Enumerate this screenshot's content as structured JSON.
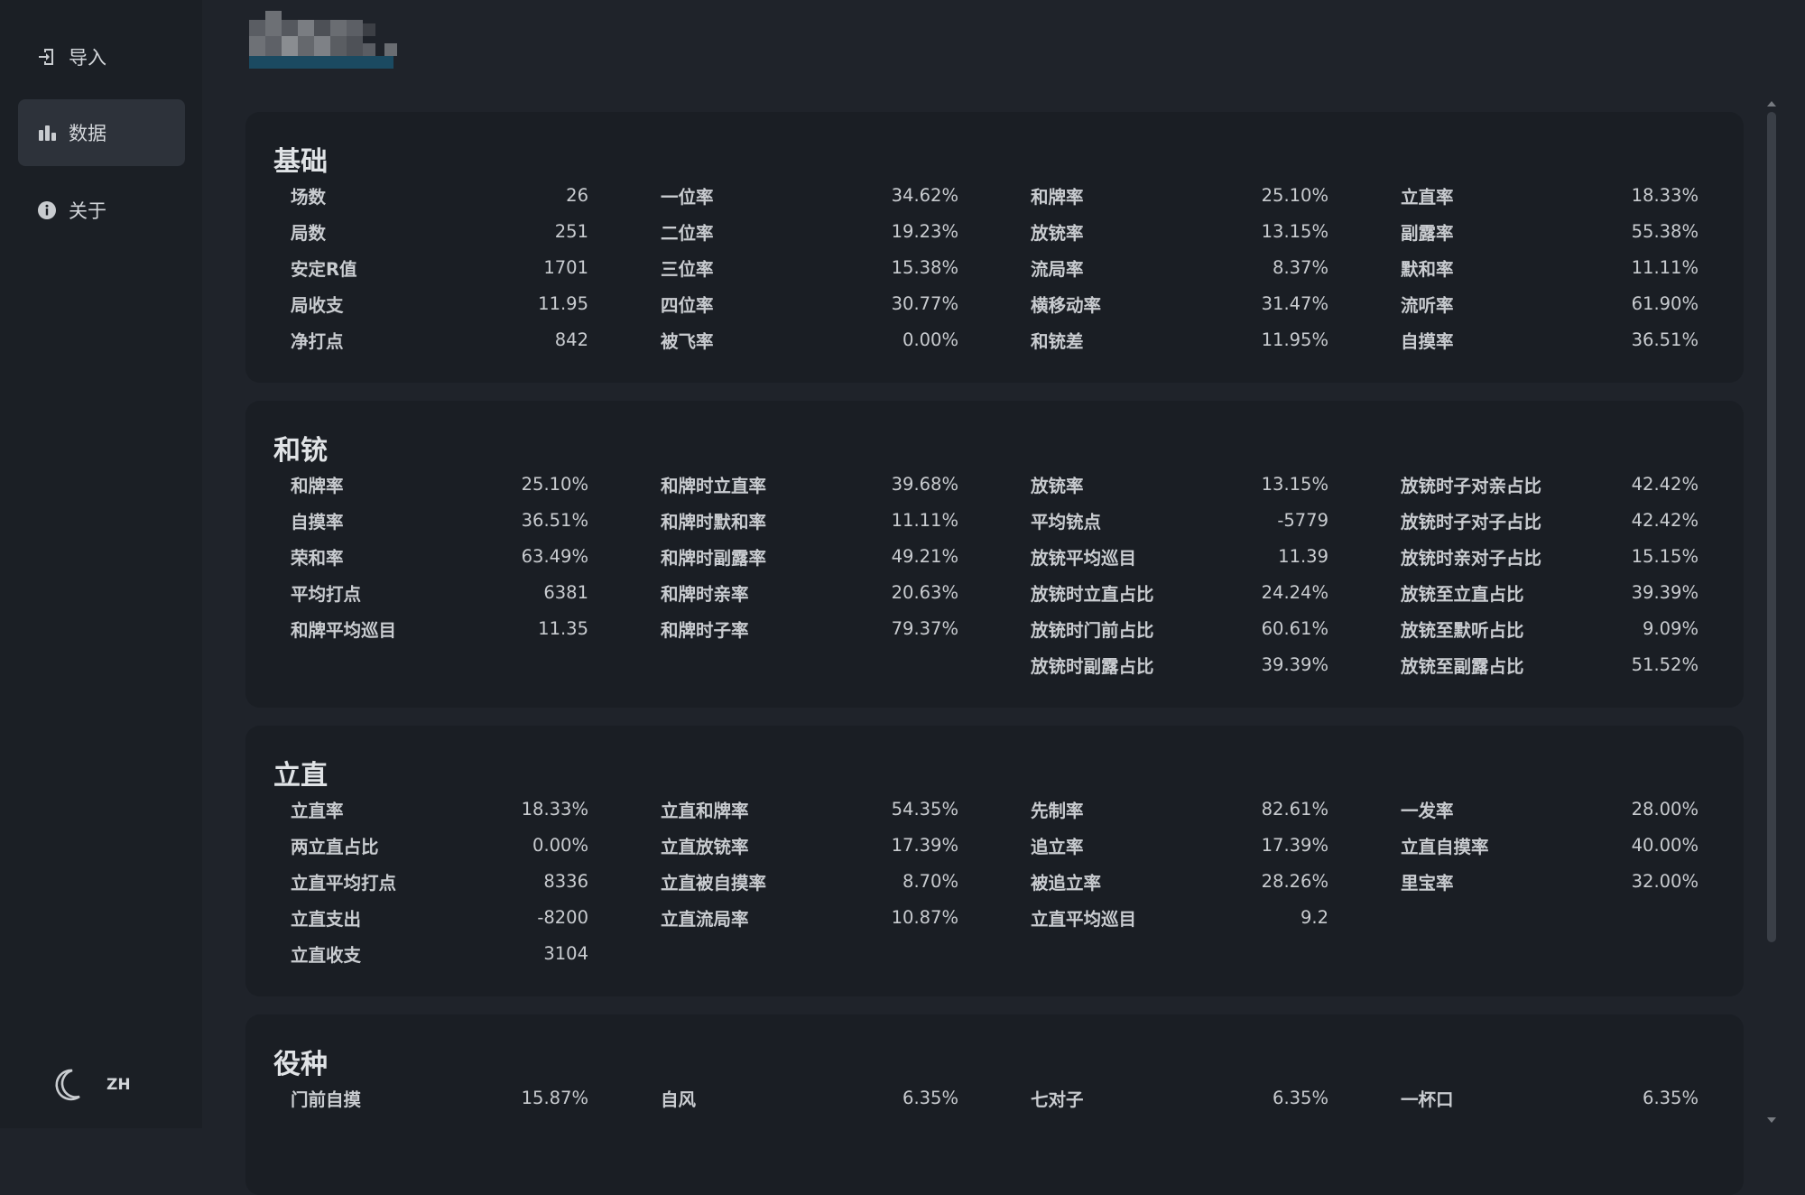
{
  "sidebar": {
    "items": [
      {
        "label": "导入",
        "icon": "import-icon"
      },
      {
        "label": "数据",
        "icon": "bar-chart-icon"
      },
      {
        "label": "关于",
        "icon": "info-icon"
      }
    ],
    "footer": {
      "theme_icon": "moon-icon",
      "lang": "ZH"
    }
  },
  "sections": [
    {
      "title": "基础",
      "columns": [
        [
          [
            "场数",
            "26"
          ],
          [
            "局数",
            "251"
          ],
          [
            "安定R值",
            "1701"
          ],
          [
            "局收支",
            "11.95"
          ],
          [
            "净打点",
            "842"
          ]
        ],
        [
          [
            "一位率",
            "34.62%"
          ],
          [
            "二位率",
            "19.23%"
          ],
          [
            "三位率",
            "15.38%"
          ],
          [
            "四位率",
            "30.77%"
          ],
          [
            "被飞率",
            "0.00%"
          ]
        ],
        [
          [
            "和牌率",
            "25.10%"
          ],
          [
            "放铳率",
            "13.15%"
          ],
          [
            "流局率",
            "8.37%"
          ],
          [
            "横移动率",
            "31.47%"
          ],
          [
            "和铳差",
            "11.95%"
          ]
        ],
        [
          [
            "立直率",
            "18.33%"
          ],
          [
            "副露率",
            "55.38%"
          ],
          [
            "默和率",
            "11.11%"
          ],
          [
            "流听率",
            "61.90%"
          ],
          [
            "自摸率",
            "36.51%"
          ]
        ]
      ]
    },
    {
      "title": "和铳",
      "columns": [
        [
          [
            "和牌率",
            "25.10%"
          ],
          [
            "自摸率",
            "36.51%"
          ],
          [
            "荣和率",
            "63.49%"
          ],
          [
            "平均打点",
            "6381"
          ],
          [
            "和牌平均巡目",
            "11.35"
          ]
        ],
        [
          [
            "和牌时立直率",
            "39.68%"
          ],
          [
            "和牌时默和率",
            "11.11%"
          ],
          [
            "和牌时副露率",
            "49.21%"
          ],
          [
            "和牌时亲率",
            "20.63%"
          ],
          [
            "和牌时子率",
            "79.37%"
          ]
        ],
        [
          [
            "放铳率",
            "13.15%"
          ],
          [
            "平均铳点",
            "-5779"
          ],
          [
            "放铳平均巡目",
            "11.39"
          ],
          [
            "放铳时立直占比",
            "24.24%"
          ],
          [
            "放铳时门前占比",
            "60.61%"
          ],
          [
            "放铳时副露占比",
            "39.39%"
          ]
        ],
        [
          [
            "放铳时子对亲占比",
            "42.42%"
          ],
          [
            "放铳时子对子占比",
            "42.42%"
          ],
          [
            "放铳时亲对子占比",
            "15.15%"
          ],
          [
            "放铳至立直占比",
            "39.39%"
          ],
          [
            "放铳至默听占比",
            "9.09%"
          ],
          [
            "放铳至副露占比",
            "51.52%"
          ]
        ]
      ]
    },
    {
      "title": "立直",
      "columns": [
        [
          [
            "立直率",
            "18.33%"
          ],
          [
            "两立直占比",
            "0.00%"
          ],
          [
            "立直平均打点",
            "8336"
          ],
          [
            "立直支出",
            "-8200"
          ],
          [
            "立直收支",
            "3104"
          ]
        ],
        [
          [
            "立直和牌率",
            "54.35%"
          ],
          [
            "立直放铳率",
            "17.39%"
          ],
          [
            "立直被自摸率",
            "8.70%"
          ],
          [
            "立直流局率",
            "10.87%"
          ]
        ],
        [
          [
            "先制率",
            "82.61%"
          ],
          [
            "追立率",
            "17.39%"
          ],
          [
            "被追立率",
            "28.26%"
          ],
          [
            "立直平均巡目",
            "9.2"
          ]
        ],
        [
          [
            "一发率",
            "28.00%"
          ],
          [
            "立直自摸率",
            "40.00%"
          ],
          [
            "里宝率",
            "32.00%"
          ]
        ]
      ]
    },
    {
      "title": "役种",
      "columns": [
        [
          [
            "门前自摸",
            "15.87%"
          ]
        ],
        [
          [
            "自风",
            "6.35%"
          ]
        ],
        [
          [
            "七对子",
            "6.35%"
          ]
        ],
        [
          [
            "一杯口",
            "6.35%"
          ]
        ]
      ]
    }
  ]
}
